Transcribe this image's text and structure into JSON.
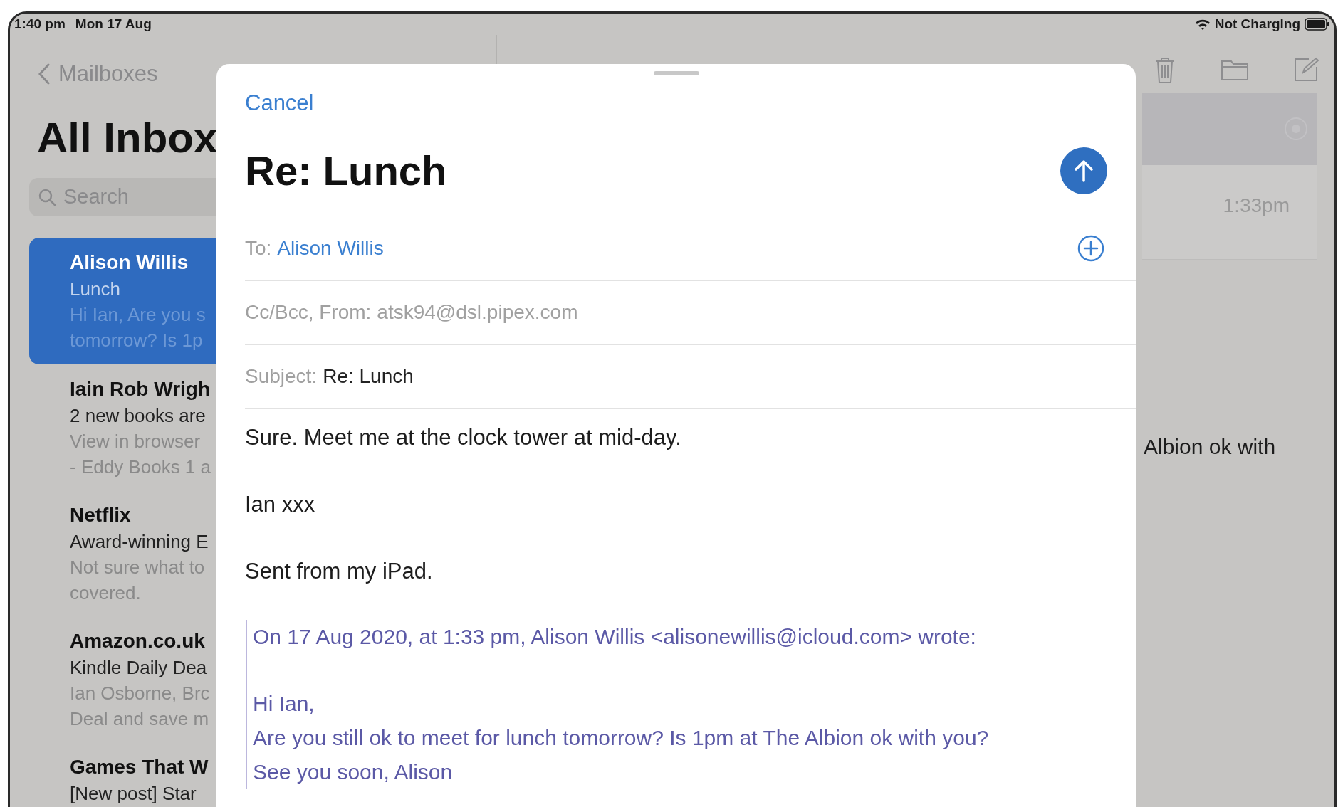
{
  "status_bar": {
    "time": "1:40 pm",
    "date": "Mon 17 Aug",
    "battery_label": "Not Charging"
  },
  "sidebar": {
    "back_label": "Mailboxes",
    "title": "All Inbox",
    "search": {
      "placeholder": "Search"
    },
    "messages": [
      {
        "sender": "Alison Willis",
        "subject": "Lunch",
        "preview": [
          "Hi Ian, Are you s",
          "tomorrow? Is 1p"
        ],
        "selected": true
      },
      {
        "sender": "Iain Rob Wrigh",
        "subject": "2 new books are",
        "preview": [
          "View in browser",
          "- Eddy Books 1 a"
        ],
        "selected": false
      },
      {
        "sender": "Netflix",
        "subject": "Award-winning E",
        "preview": [
          "Not sure what to",
          "covered."
        ],
        "selected": false
      },
      {
        "sender": "Amazon.co.uk",
        "subject": "Kindle Daily Dea",
        "preview": [
          "Ian Osborne, Brc",
          "Deal and save m"
        ],
        "selected": false
      },
      {
        "sender": "Games That W",
        "subject": "[New post] Star",
        "selected": false
      }
    ]
  },
  "detail": {
    "time": "1:33pm",
    "body_fragment": "Albion ok with"
  },
  "compose": {
    "cancel": "Cancel",
    "title": "Re: Lunch",
    "fields": [
      {
        "kind": "recipient",
        "label": "To:",
        "value": "Alison Willis"
      },
      {
        "kind": "plain",
        "label": "Cc/Bcc, From:",
        "value": "atsk94@dsl.pipex.com"
      },
      {
        "kind": "subject",
        "label": "Subject:",
        "value": "Re: Lunch"
      }
    ],
    "body": [
      "Sure. Meet me at the clock tower at mid-day.",
      "Ian xxx",
      "Sent from my iPad."
    ],
    "quote": {
      "header": "On 17 Aug 2020, at 1:33 pm, Alison Willis <alisonewillis@icloud.com> wrote:",
      "lines": [
        "Hi Ian,",
        "Are you still ok to meet for lunch tomorrow? Is 1pm at The Albion ok with you?",
        "See you soon, Alison"
      ]
    }
  }
}
